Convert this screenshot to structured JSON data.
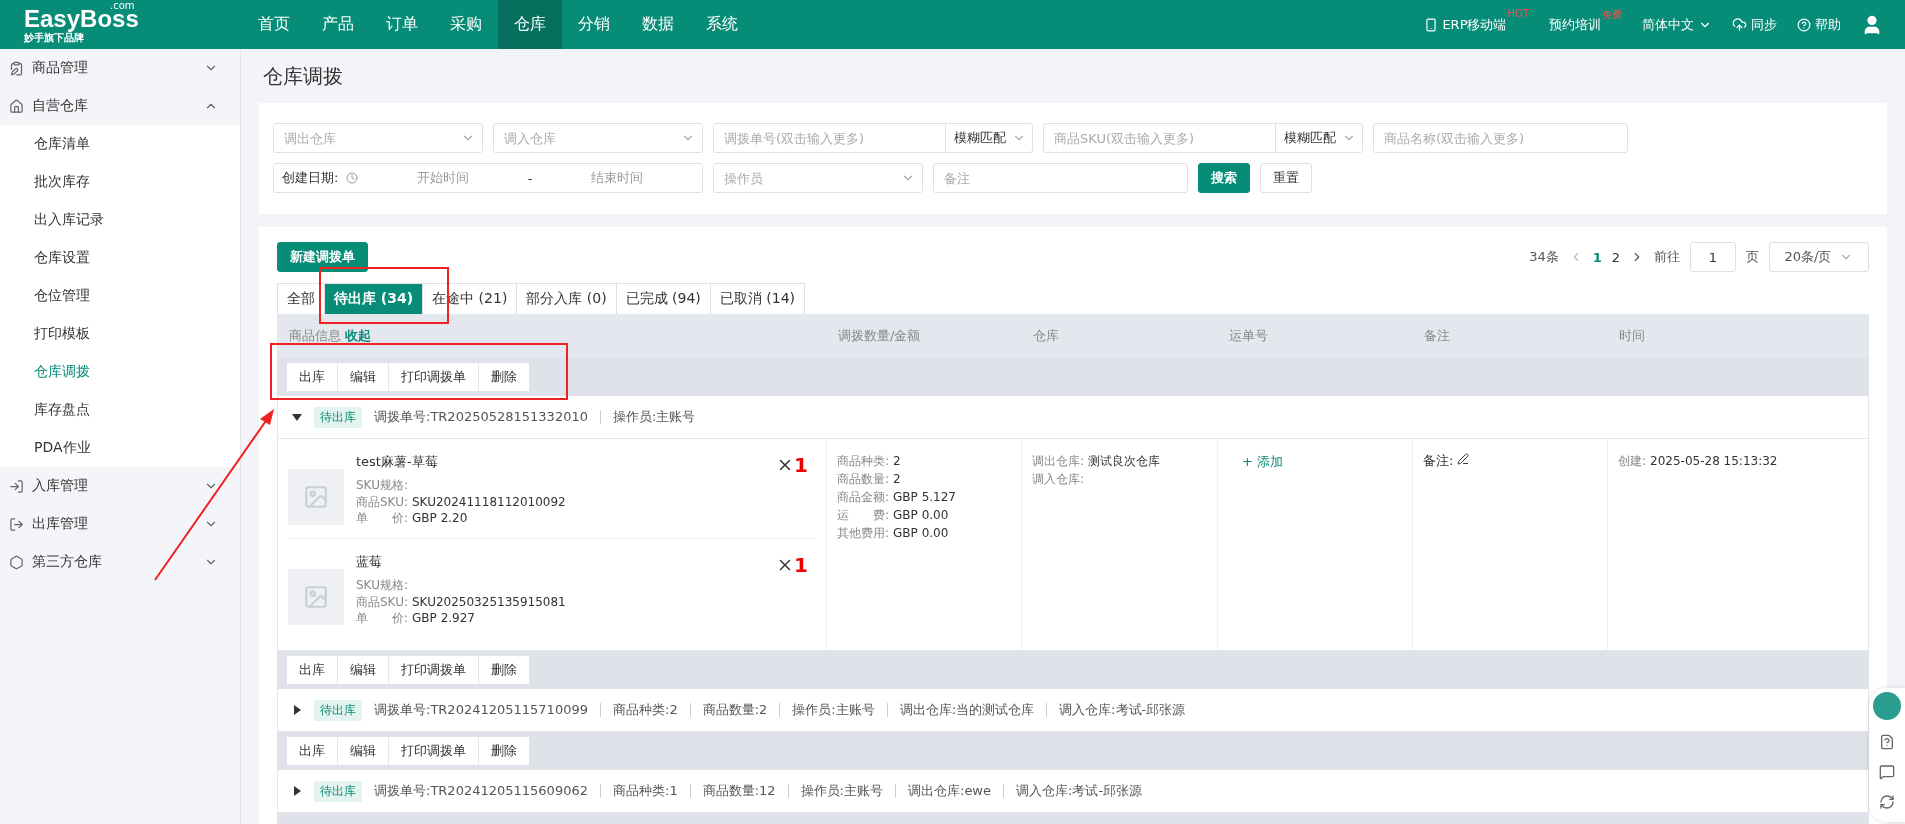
{
  "header": {
    "logo": {
      "name": "EasyBoss",
      "sup": ".com",
      "sub": "妙手旗下品牌"
    },
    "nav": [
      {
        "label": "首页",
        "selected": false
      },
      {
        "label": "产品",
        "selected": false
      },
      {
        "label": "订单",
        "selected": false
      },
      {
        "label": "采购",
        "selected": false
      },
      {
        "label": "仓库",
        "selected": true
      },
      {
        "label": "分销",
        "selected": false
      },
      {
        "label": "数据",
        "selected": false
      },
      {
        "label": "系统",
        "selected": false
      }
    ],
    "right": [
      {
        "kind": "phone",
        "label": "ERP移动端",
        "badge": "HOT"
      },
      {
        "kind": "plain",
        "label": "预约培训",
        "badge": "免费"
      },
      {
        "kind": "language",
        "label": "简体中文"
      },
      {
        "kind": "sync",
        "label": "同步"
      },
      {
        "kind": "help",
        "label": "帮助"
      },
      {
        "kind": "user"
      }
    ]
  },
  "sidebar": [
    {
      "kind": "goods",
      "label": "商品管理",
      "expanded": false
    },
    {
      "kind": "home",
      "label": "自营仓库",
      "expanded": true,
      "children": [
        {
          "label": "仓库清单",
          "selected": false
        },
        {
          "label": "批次库存",
          "selected": false
        },
        {
          "label": "出入库记录",
          "selected": false
        },
        {
          "label": "仓库设置",
          "selected": false
        },
        {
          "label": "仓位管理",
          "selected": false
        },
        {
          "label": "打印模板",
          "selected": false
        },
        {
          "label": "仓库调拨",
          "selected": true
        },
        {
          "label": "库存盘点",
          "selected": false
        },
        {
          "label": "PDA作业",
          "selected": false
        }
      ]
    },
    {
      "kind": "in",
      "label": "入库管理",
      "expanded": false
    },
    {
      "kind": "out",
      "label": "出库管理",
      "expanded": false
    },
    {
      "kind": "third",
      "label": "第三方仓库",
      "expanded": false
    }
  ],
  "page_title": "仓库调拨",
  "filters": {
    "row_1": [
      {
        "kind": "select",
        "placeholder": "调出仓库"
      },
      {
        "kind": "select",
        "placeholder": "调入仓库"
      },
      {
        "kind": "match",
        "placeholder": "调拨单号(双击输入更多)",
        "match": "模糊匹配"
      },
      {
        "kind": "match",
        "placeholder": "商品SKU(双击输入更多)",
        "match": "模糊匹配"
      },
      {
        "kind": "input",
        "placeholder": "商品名称(双击输入更多)"
      }
    ],
    "row_2": [
      {
        "kind": "date",
        "label": "创建日期:",
        "start": "开始时间",
        "sep": "-",
        "end": "结束时间"
      },
      {
        "kind": "select",
        "placeholder": "操作员"
      },
      {
        "kind": "input",
        "placeholder": "备注"
      }
    ],
    "search_button": "搜索",
    "reset_button": "重置"
  },
  "new_button": "新建调拨单",
  "pagination": {
    "total": "34条",
    "pages": [
      {
        "label": "1",
        "selected": true
      },
      {
        "label": "2",
        "selected": false
      }
    ],
    "goto": "前往",
    "page_value": "1",
    "page_unit": "页",
    "page_size": "20条/页"
  },
  "tabs": [
    {
      "label": "全部",
      "selected": false
    },
    {
      "label": "待出库 (34)",
      "selected": true
    },
    {
      "label": "在途中 (21)",
      "selected": false
    },
    {
      "label": "部分入库 (0)",
      "selected": false
    },
    {
      "label": "已完成 (94)",
      "selected": false
    },
    {
      "label": "已取消 (14)",
      "selected": false
    }
  ],
  "table": {
    "columns": [
      {
        "label": "商品信息",
        "link": "收起"
      },
      {
        "label": "调拨数量/金额"
      },
      {
        "label": "仓库"
      },
      {
        "label": "运单号"
      },
      {
        "label": "备注"
      },
      {
        "label": "时间"
      }
    ],
    "batch_actions": [
      "出库",
      "编辑",
      "打印调拨单",
      "删除"
    ],
    "orders": [
      {
        "expanded": true,
        "status": "待出库",
        "fields": [
          {
            "label": "调拨单号:",
            "value": "TR20250528151332010"
          },
          {
            "label": "操作员:",
            "value": "主账号"
          }
        ],
        "items": [
          {
            "name": "test麻薯-草莓",
            "spec_label": "SKU规格:",
            "sku_label": "商品SKU:",
            "sku": "SKU20241118112010092",
            "price_label": "单　　价:",
            "price": "GBP 2.20",
            "qty": "1"
          },
          {
            "name": "蓝莓",
            "spec_label": "SKU规格:",
            "sku_label": "商品SKU:",
            "sku": "SKU20250325135915081",
            "price_label": "单　　价:",
            "price": "GBP 2.927",
            "qty": "1"
          }
        ],
        "amounts": [
          {
            "label": "商品种类:",
            "value": "2"
          },
          {
            "label": "商品数量:",
            "value": "2"
          },
          {
            "label": "商品金额:",
            "value": "GBP 5.127"
          },
          {
            "label": "运　　费:",
            "value": "GBP 0.00"
          },
          {
            "label": "其他费用:",
            "value": "GBP 0.00"
          }
        ],
        "warehouse": [
          {
            "label": "调出仓库:",
            "value": "测试良次仓库"
          },
          {
            "label": "调入仓库:"
          }
        ],
        "tracking_link": "+ 添加",
        "note_label": "备注:",
        "time": {
          "label": "创建:",
          "value": "2025-05-28 15:13:32"
        },
        "actions": [
          "出库",
          "编辑",
          "打印调拨单",
          "删除"
        ]
      },
      {
        "expanded": false,
        "status": "待出库",
        "fields": [
          {
            "label": "调拨单号:",
            "value": "TR20241205115710099"
          },
          {
            "label": "商品种类:",
            "value": "2"
          },
          {
            "label": "商品数量:",
            "value": "2"
          },
          {
            "label": "操作员:",
            "value": "主账号"
          },
          {
            "label": "调出仓库:",
            "value": "当的测试仓库"
          },
          {
            "label": "调入仓库:",
            "value": "考试-邱张源"
          }
        ],
        "actions": [
          "出库",
          "编辑",
          "打印调拨单",
          "删除"
        ]
      },
      {
        "expanded": false,
        "status": "待出库",
        "fields": [
          {
            "label": "调拨单号:",
            "value": "TR20241205115609062"
          },
          {
            "label": "商品种类:",
            "value": "1"
          },
          {
            "label": "商品数量:",
            "value": "12"
          },
          {
            "label": "操作员:",
            "value": "主账号"
          },
          {
            "label": "调出仓库:",
            "value": "ewe"
          },
          {
            "label": "调入仓库:",
            "value": "考试-邱张源"
          }
        ]
      }
    ]
  }
}
